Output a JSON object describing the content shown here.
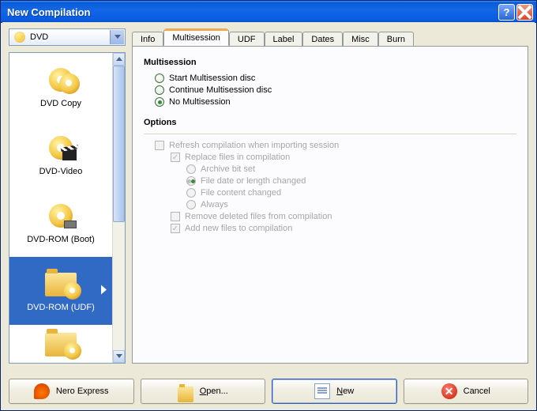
{
  "window": {
    "title": "New Compilation"
  },
  "dropdown": {
    "label": "DVD"
  },
  "sidebar": {
    "items": [
      {
        "label": "DVD Copy"
      },
      {
        "label": "DVD-Video"
      },
      {
        "label": "DVD-ROM (Boot)"
      },
      {
        "label": "DVD-ROM (UDF)"
      }
    ]
  },
  "tabs": [
    "Info",
    "Multisession",
    "UDF",
    "Label",
    "Dates",
    "Misc",
    "Burn"
  ],
  "active_tab": "Multisession",
  "panel": {
    "group1": "Multisession",
    "radios": {
      "start": "Start Multisession disc",
      "cont": "Continue Multisession disc",
      "none": "No Multisession"
    },
    "group2": "Options",
    "opts": {
      "refresh": "Refresh compilation when importing session",
      "replace": "Replace files in compilation",
      "archive": "Archive bit set",
      "filedate": "File date or length changed",
      "filecontent": "File content changed",
      "always": "Always",
      "remove": "Remove deleted files from compilation",
      "addnew": "Add new files to compilation"
    }
  },
  "buttons": {
    "express": "Nero Express",
    "open": "Open...",
    "new": "New",
    "cancel": "Cancel"
  }
}
